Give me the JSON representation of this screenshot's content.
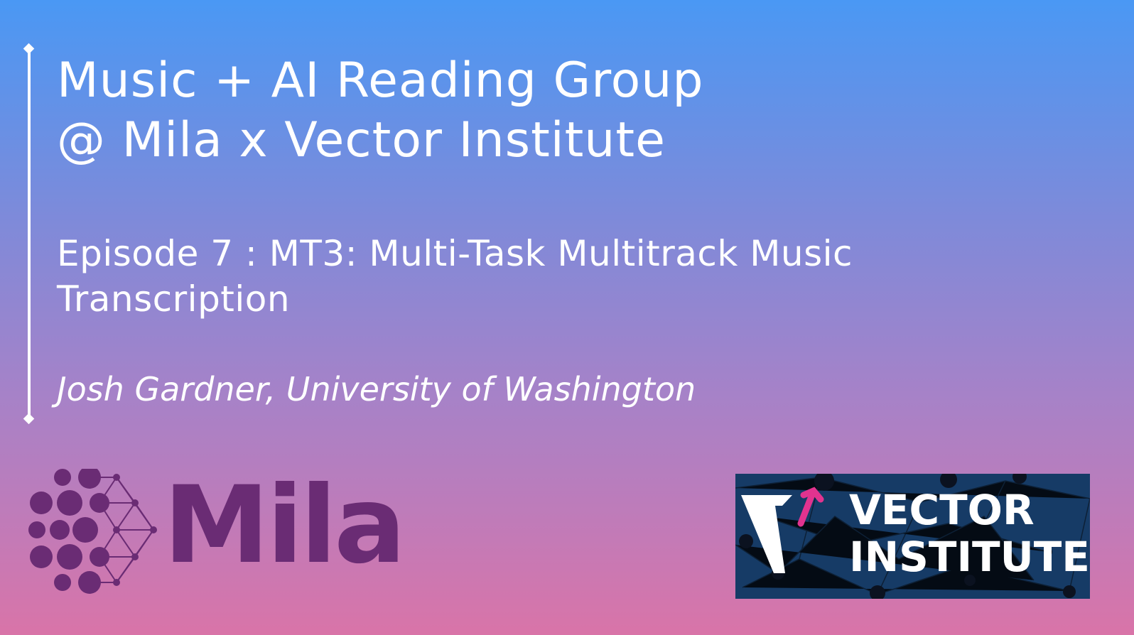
{
  "slide": {
    "title_lines": [
      "Music + AI Reading Group",
      "@ Mila x Vector Institute"
    ],
    "episode_lines": [
      "Episode 7 : MT3: Multi-Task Multitrack Music",
      "Transcription"
    ],
    "speaker": "Josh Gardner, University of Washington"
  },
  "logos": {
    "mila": {
      "wordmark": "Mila",
      "color": "#6a2c74",
      "icon": "mila-network-icon"
    },
    "vector": {
      "lines": [
        "VECTOR",
        "INSTITUTE"
      ],
      "background": "#163b66",
      "accent": "#e2338f",
      "icon": "vector-v-arrow-icon"
    }
  },
  "colors": {
    "gradient_top": "#4a98f4",
    "gradient_bottom": "#d974a8",
    "text": "#ffffff"
  }
}
